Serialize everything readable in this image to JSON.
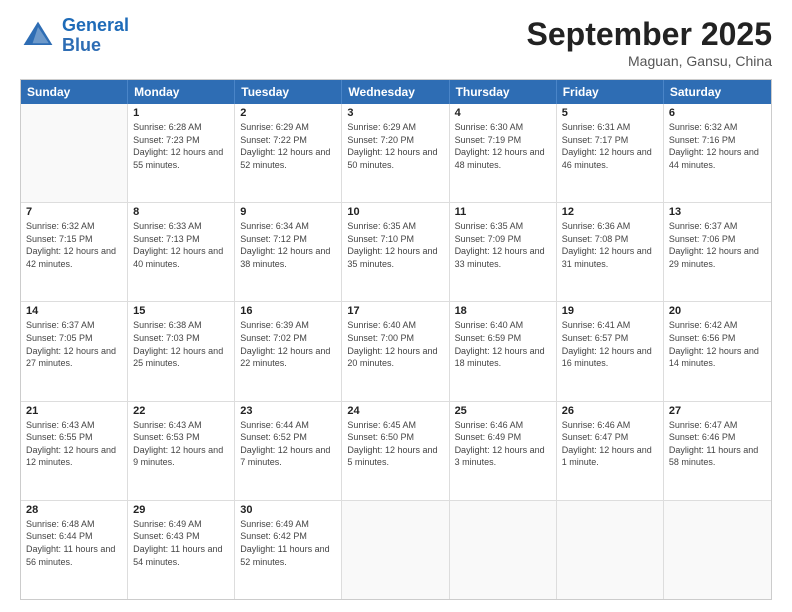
{
  "header": {
    "logo_line1": "General",
    "logo_line2": "Blue",
    "month_title": "September 2025",
    "location": "Maguan, Gansu, China"
  },
  "days_of_week": [
    "Sunday",
    "Monday",
    "Tuesday",
    "Wednesday",
    "Thursday",
    "Friday",
    "Saturday"
  ],
  "weeks": [
    [
      {
        "day": "",
        "sunrise": "",
        "sunset": "",
        "daylight": ""
      },
      {
        "day": "1",
        "sunrise": "Sunrise: 6:28 AM",
        "sunset": "Sunset: 7:23 PM",
        "daylight": "Daylight: 12 hours and 55 minutes."
      },
      {
        "day": "2",
        "sunrise": "Sunrise: 6:29 AM",
        "sunset": "Sunset: 7:22 PM",
        "daylight": "Daylight: 12 hours and 52 minutes."
      },
      {
        "day": "3",
        "sunrise": "Sunrise: 6:29 AM",
        "sunset": "Sunset: 7:20 PM",
        "daylight": "Daylight: 12 hours and 50 minutes."
      },
      {
        "day": "4",
        "sunrise": "Sunrise: 6:30 AM",
        "sunset": "Sunset: 7:19 PM",
        "daylight": "Daylight: 12 hours and 48 minutes."
      },
      {
        "day": "5",
        "sunrise": "Sunrise: 6:31 AM",
        "sunset": "Sunset: 7:17 PM",
        "daylight": "Daylight: 12 hours and 46 minutes."
      },
      {
        "day": "6",
        "sunrise": "Sunrise: 6:32 AM",
        "sunset": "Sunset: 7:16 PM",
        "daylight": "Daylight: 12 hours and 44 minutes."
      }
    ],
    [
      {
        "day": "7",
        "sunrise": "Sunrise: 6:32 AM",
        "sunset": "Sunset: 7:15 PM",
        "daylight": "Daylight: 12 hours and 42 minutes."
      },
      {
        "day": "8",
        "sunrise": "Sunrise: 6:33 AM",
        "sunset": "Sunset: 7:13 PM",
        "daylight": "Daylight: 12 hours and 40 minutes."
      },
      {
        "day": "9",
        "sunrise": "Sunrise: 6:34 AM",
        "sunset": "Sunset: 7:12 PM",
        "daylight": "Daylight: 12 hours and 38 minutes."
      },
      {
        "day": "10",
        "sunrise": "Sunrise: 6:35 AM",
        "sunset": "Sunset: 7:10 PM",
        "daylight": "Daylight: 12 hours and 35 minutes."
      },
      {
        "day": "11",
        "sunrise": "Sunrise: 6:35 AM",
        "sunset": "Sunset: 7:09 PM",
        "daylight": "Daylight: 12 hours and 33 minutes."
      },
      {
        "day": "12",
        "sunrise": "Sunrise: 6:36 AM",
        "sunset": "Sunset: 7:08 PM",
        "daylight": "Daylight: 12 hours and 31 minutes."
      },
      {
        "day": "13",
        "sunrise": "Sunrise: 6:37 AM",
        "sunset": "Sunset: 7:06 PM",
        "daylight": "Daylight: 12 hours and 29 minutes."
      }
    ],
    [
      {
        "day": "14",
        "sunrise": "Sunrise: 6:37 AM",
        "sunset": "Sunset: 7:05 PM",
        "daylight": "Daylight: 12 hours and 27 minutes."
      },
      {
        "day": "15",
        "sunrise": "Sunrise: 6:38 AM",
        "sunset": "Sunset: 7:03 PM",
        "daylight": "Daylight: 12 hours and 25 minutes."
      },
      {
        "day": "16",
        "sunrise": "Sunrise: 6:39 AM",
        "sunset": "Sunset: 7:02 PM",
        "daylight": "Daylight: 12 hours and 22 minutes."
      },
      {
        "day": "17",
        "sunrise": "Sunrise: 6:40 AM",
        "sunset": "Sunset: 7:00 PM",
        "daylight": "Daylight: 12 hours and 20 minutes."
      },
      {
        "day": "18",
        "sunrise": "Sunrise: 6:40 AM",
        "sunset": "Sunset: 6:59 PM",
        "daylight": "Daylight: 12 hours and 18 minutes."
      },
      {
        "day": "19",
        "sunrise": "Sunrise: 6:41 AM",
        "sunset": "Sunset: 6:57 PM",
        "daylight": "Daylight: 12 hours and 16 minutes."
      },
      {
        "day": "20",
        "sunrise": "Sunrise: 6:42 AM",
        "sunset": "Sunset: 6:56 PM",
        "daylight": "Daylight: 12 hours and 14 minutes."
      }
    ],
    [
      {
        "day": "21",
        "sunrise": "Sunrise: 6:43 AM",
        "sunset": "Sunset: 6:55 PM",
        "daylight": "Daylight: 12 hours and 12 minutes."
      },
      {
        "day": "22",
        "sunrise": "Sunrise: 6:43 AM",
        "sunset": "Sunset: 6:53 PM",
        "daylight": "Daylight: 12 hours and 9 minutes."
      },
      {
        "day": "23",
        "sunrise": "Sunrise: 6:44 AM",
        "sunset": "Sunset: 6:52 PM",
        "daylight": "Daylight: 12 hours and 7 minutes."
      },
      {
        "day": "24",
        "sunrise": "Sunrise: 6:45 AM",
        "sunset": "Sunset: 6:50 PM",
        "daylight": "Daylight: 12 hours and 5 minutes."
      },
      {
        "day": "25",
        "sunrise": "Sunrise: 6:46 AM",
        "sunset": "Sunset: 6:49 PM",
        "daylight": "Daylight: 12 hours and 3 minutes."
      },
      {
        "day": "26",
        "sunrise": "Sunrise: 6:46 AM",
        "sunset": "Sunset: 6:47 PM",
        "daylight": "Daylight: 12 hours and 1 minute."
      },
      {
        "day": "27",
        "sunrise": "Sunrise: 6:47 AM",
        "sunset": "Sunset: 6:46 PM",
        "daylight": "Daylight: 11 hours and 58 minutes."
      }
    ],
    [
      {
        "day": "28",
        "sunrise": "Sunrise: 6:48 AM",
        "sunset": "Sunset: 6:44 PM",
        "daylight": "Daylight: 11 hours and 56 minutes."
      },
      {
        "day": "29",
        "sunrise": "Sunrise: 6:49 AM",
        "sunset": "Sunset: 6:43 PM",
        "daylight": "Daylight: 11 hours and 54 minutes."
      },
      {
        "day": "30",
        "sunrise": "Sunrise: 6:49 AM",
        "sunset": "Sunset: 6:42 PM",
        "daylight": "Daylight: 11 hours and 52 minutes."
      },
      {
        "day": "",
        "sunrise": "",
        "sunset": "",
        "daylight": ""
      },
      {
        "day": "",
        "sunrise": "",
        "sunset": "",
        "daylight": ""
      },
      {
        "day": "",
        "sunrise": "",
        "sunset": "",
        "daylight": ""
      },
      {
        "day": "",
        "sunrise": "",
        "sunset": "",
        "daylight": ""
      }
    ]
  ]
}
